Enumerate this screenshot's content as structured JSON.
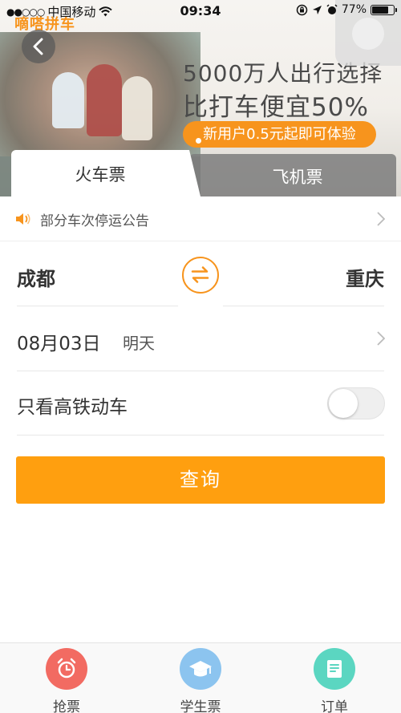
{
  "status_bar": {
    "signal": "●●○○○",
    "carrier": "中国移动",
    "time": "09:34",
    "battery_percent": "77%",
    "battery_level": 0.77
  },
  "banner": {
    "logo": "嘀嗒拼车",
    "headline": "5000万人出行选择",
    "subheadline": "比打车便宜50%",
    "cta": "新用户0.5元起即可体验"
  },
  "tabs": [
    {
      "label": "火车票",
      "active": true
    },
    {
      "label": "飞机票",
      "active": false
    }
  ],
  "notice": {
    "text": "部分车次停运公告"
  },
  "route": {
    "from": "成都",
    "to": "重庆"
  },
  "date": {
    "value": "08月03日",
    "relative": "明天"
  },
  "high_speed_filter": {
    "label": "只看高铁动车",
    "enabled": false
  },
  "search_button": {
    "label": "查询"
  },
  "bottom_nav": [
    {
      "label": "抢票",
      "icon": "alarm-clock-icon",
      "color": "#f26b62"
    },
    {
      "label": "学生票",
      "icon": "graduation-cap-icon",
      "color": "#8cc4ef"
    },
    {
      "label": "订单",
      "icon": "order-list-icon",
      "color": "#5bd6c1"
    }
  ],
  "colors": {
    "accent": "#f7941d",
    "button": "#ff9f0f"
  }
}
